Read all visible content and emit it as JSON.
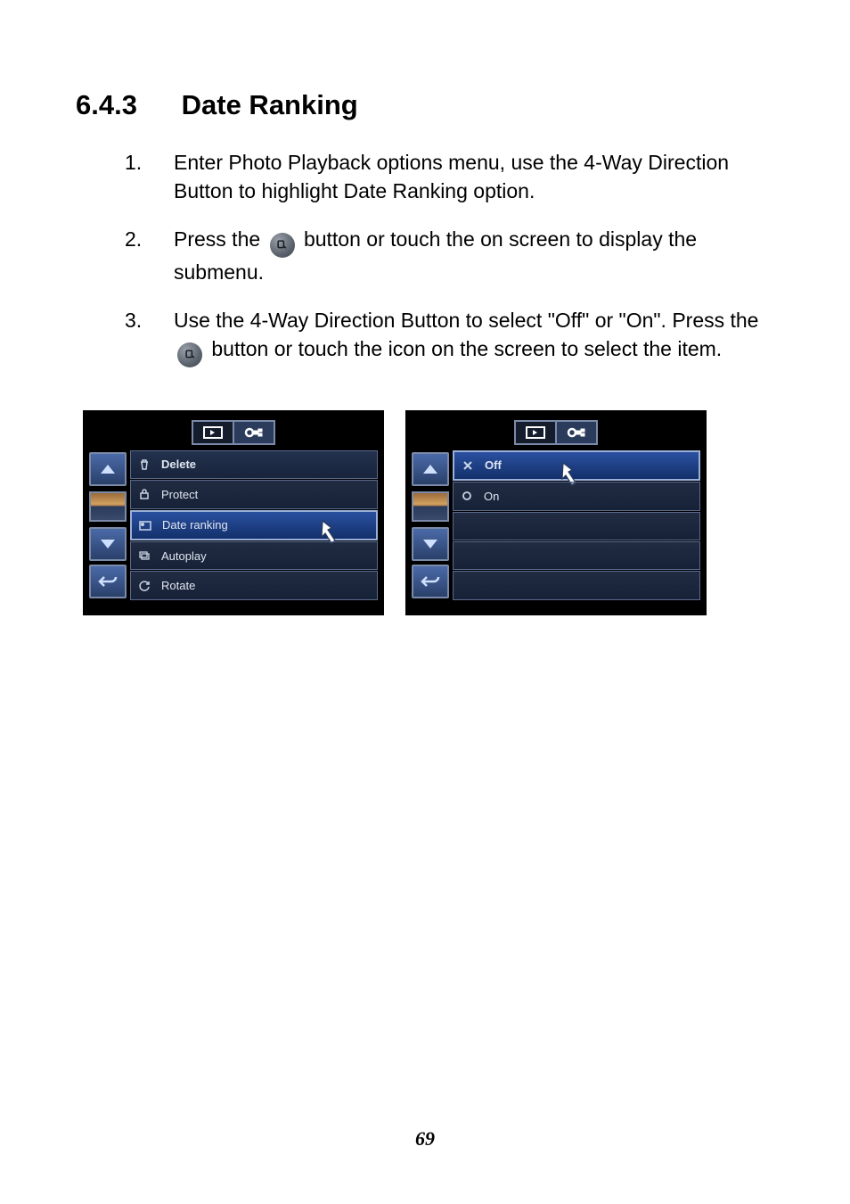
{
  "heading": {
    "section_number": "6.4.3",
    "title": "Date Ranking"
  },
  "steps": [
    {
      "n": "1.",
      "text_a": "Enter Photo Playback options menu, use the 4-Way Direction Button to highlight Date Ranking option."
    },
    {
      "n": "2.",
      "text_a": "Press the ",
      "text_b": " button or touch the on screen to display the submenu."
    },
    {
      "n": "3.",
      "text_a": "Use the 4-Way Direction Button to select \"Off\" or \"On\". Press the ",
      "text_b": " button or touch the icon on the screen to select the item."
    }
  ],
  "screen1": {
    "menu": [
      {
        "label": "Delete",
        "icon": "trash-icon",
        "selected": false,
        "bold": true
      },
      {
        "label": "Protect",
        "icon": "lock-icon",
        "selected": false
      },
      {
        "label": "Date ranking",
        "icon": "calendar-icon",
        "selected": true
      },
      {
        "label": "Autoplay",
        "icon": "slideshow-icon",
        "selected": false
      },
      {
        "label": "Rotate",
        "icon": "rotate-icon",
        "selected": false
      }
    ]
  },
  "screen2": {
    "menu": [
      {
        "label": "Off",
        "icon": "x-icon",
        "selected": true,
        "bold": true
      },
      {
        "label": "On",
        "icon": "circle-icon",
        "selected": false
      },
      {
        "label": "",
        "icon": "",
        "selected": false
      },
      {
        "label": "",
        "icon": "",
        "selected": false
      },
      {
        "label": "",
        "icon": "",
        "selected": false
      }
    ]
  },
  "page_number": "69"
}
